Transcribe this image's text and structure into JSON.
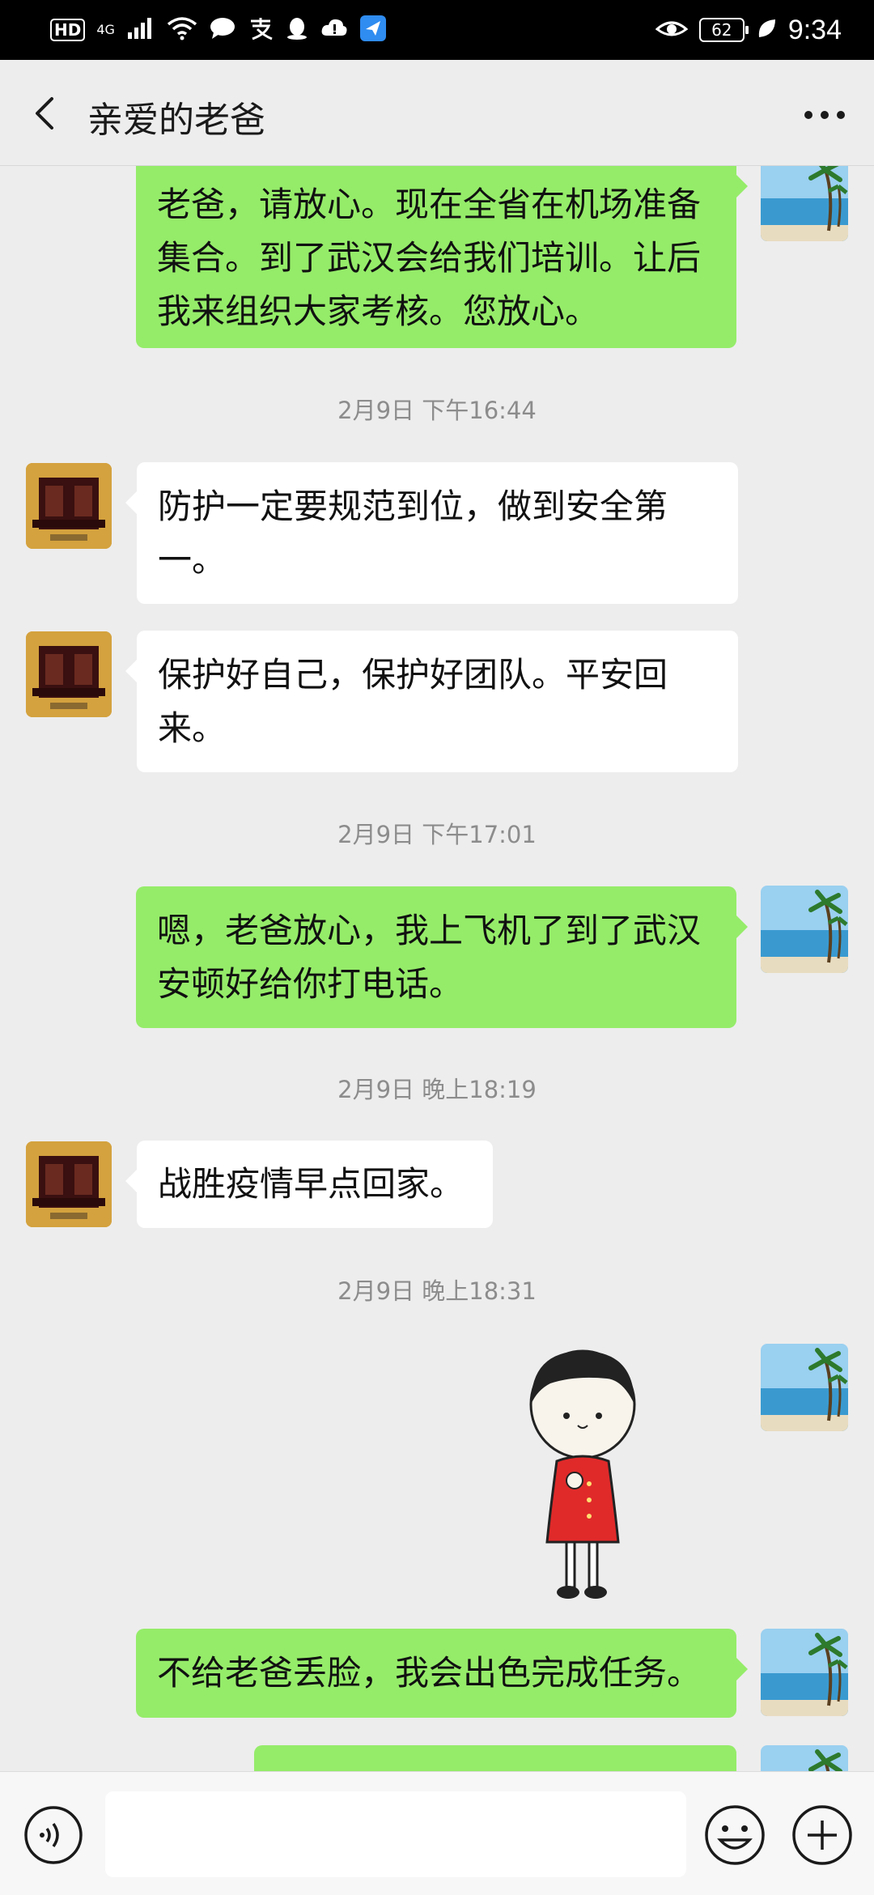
{
  "status_bar": {
    "hd_label": "HD",
    "network_label": "4G",
    "battery_level": "62",
    "time": "9:34"
  },
  "header": {
    "title": "亲爱的老爸"
  },
  "messages": [
    {
      "type": "out",
      "text": "老爸，请放心。现在全省在机场准备集合。到了武汉会给我们培训。让后我来组织大家考核。您放心。"
    },
    {
      "type": "time",
      "text": "2月9日 下午16:44"
    },
    {
      "type": "in",
      "text": "防护一定要规范到位，做到安全第一。"
    },
    {
      "type": "in",
      "text": "保护好自己，保护好团队。平安回来。"
    },
    {
      "type": "time",
      "text": "2月9日 下午17:01"
    },
    {
      "type": "out",
      "text": "嗯，老爸放心，我上飞机了到了武汉安顿好给你打电话。"
    },
    {
      "type": "time",
      "text": "2月9日 晚上18:19"
    },
    {
      "type": "in",
      "text": "战胜疫情早点回家。"
    },
    {
      "type": "time",
      "text": "2月9日 晚上18:31"
    },
    {
      "type": "sticker",
      "icon": "cartoon-girl-sticker"
    },
    {
      "type": "out",
      "text": "不给老爸丢脸，我会出色完成任务。"
    },
    {
      "type": "out",
      "text": ""
    }
  ],
  "input_bar": {
    "message_placeholder": ""
  },
  "colors": {
    "outgoing_bubble": "#95ec69",
    "incoming_bubble": "#ffffff",
    "background": "#ededed"
  }
}
